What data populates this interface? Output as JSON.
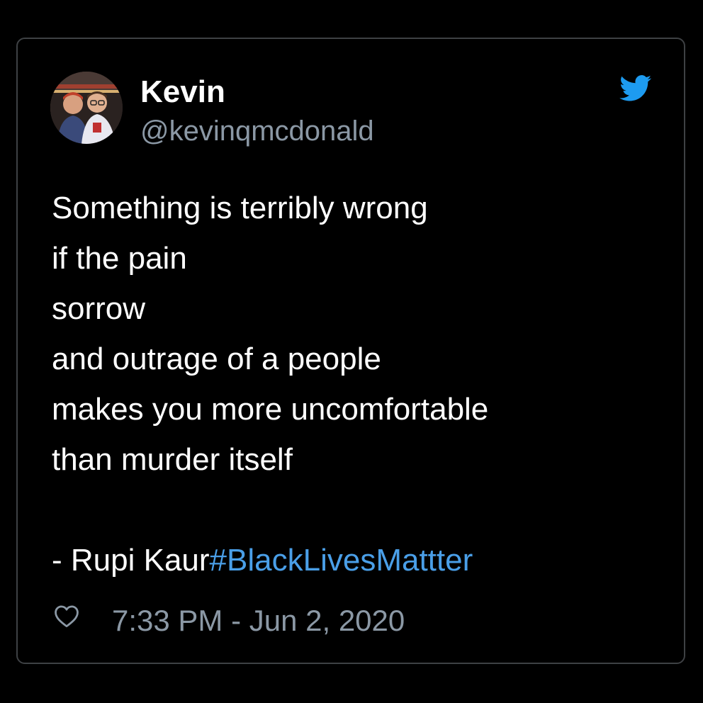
{
  "tweet": {
    "author": {
      "display_name": "Kevin",
      "handle": "@kevinqmcdonald",
      "avatar_icon": "avatar-photo"
    },
    "platform_icon": "twitter-bird-icon",
    "body_lines": [
      "Something is terribly wrong",
      "if the pain",
      "sorrow",
      "and outrage of a people",
      "makes you more uncomfortable",
      "than murder itself"
    ],
    "signature": "- Rupi Kaur",
    "hashtag": "#BlackLivesMattter",
    "timestamp": "7:33 PM - Jun 2, 2020",
    "like_icon": "heart-outline-icon"
  },
  "colors": {
    "background": "#000000",
    "border": "#3e4144",
    "text_primary": "#ffffff",
    "text_secondary": "#8b98a5",
    "hashtag": "#4a9fe8",
    "twitter_blue": "#1d9bf0"
  }
}
